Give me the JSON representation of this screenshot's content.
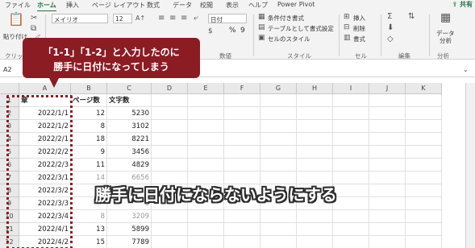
{
  "tabs": [
    "ファイル",
    "ホーム",
    "挿入",
    "ページ レイアウト",
    "数式",
    "データ",
    "校閲",
    "表示",
    "ヘルプ",
    "Power Pivot"
  ],
  "share_label": "共有",
  "ribbon": {
    "paste_label": "貼り付け",
    "clipboard_label": "クリップ",
    "font_name": "メイリオ",
    "font_size": "12",
    "number_format": "日付",
    "percent": "%",
    "comma": "9",
    "number_group": "数値",
    "conditional_format": "条件付き書式",
    "table_format": "テーブルとして書式設定",
    "cell_style": "セルのスタイル",
    "style_group": "スタイル",
    "insert": "挿入",
    "delete": "削除",
    "format": "書式",
    "cells_group": "セル",
    "edit_group": "編集",
    "data_analysis_l1": "データ",
    "data_analysis_l2": "分析",
    "analysis_group": "分析"
  },
  "formula_bar": {
    "name_box": "A2"
  },
  "columns": [
    "A",
    "B",
    "C",
    "D",
    "E",
    "F",
    "G",
    "H",
    "I",
    "J",
    "K"
  ],
  "headers": {
    "a": "章",
    "b": "ページ数",
    "c": "文字数"
  },
  "rows": [
    {
      "row": "1"
    },
    {
      "row": "2",
      "a": "2022/1/1",
      "b": "12",
      "c": "5230"
    },
    {
      "row": "3",
      "a": "2022/1/2",
      "b": "8",
      "c": "3102"
    },
    {
      "row": "4",
      "a": "2022/2/1",
      "b": "18",
      "c": "8221"
    },
    {
      "row": "5",
      "a": "2022/2/2",
      "b": "9",
      "c": "3456"
    },
    {
      "row": "6",
      "a": "2022/2/3",
      "b": "11",
      "c": "4829"
    },
    {
      "row": "7",
      "a": "2022/3/1",
      "b": "14",
      "c": "6656"
    },
    {
      "row": "8",
      "a": "2022/3/2",
      "b": "",
      "c": ""
    },
    {
      "row": "9",
      "a": "2022/3/3",
      "b": "",
      "c": "8"
    },
    {
      "row": "10",
      "a": "2022/3/4",
      "b": "8",
      "c": "3209"
    },
    {
      "row": "11",
      "a": "2022/4/1",
      "b": "13",
      "c": "5899"
    },
    {
      "row": "12",
      "a": "2022/4/2",
      "b": "15",
      "c": "7789"
    }
  ],
  "callout": {
    "line1": "「1-1」「1-2」と入力したのに",
    "line2": "勝手に日付になってしまう"
  },
  "caption": "勝手に日付にならないようにする",
  "colors": {
    "accent": "#217346",
    "callout": "#8b1c24"
  }
}
